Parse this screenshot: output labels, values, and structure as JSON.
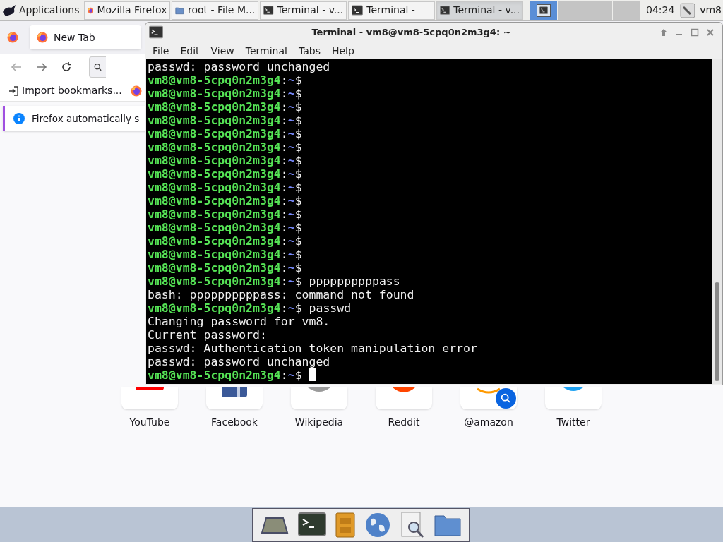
{
  "taskbar": {
    "apps_menu": "Applications",
    "tasks": [
      {
        "kind": "firefox",
        "label": "Mozilla Firefox",
        "selected": false
      },
      {
        "kind": "folder",
        "label": "root - File M...",
        "selected": false
      },
      {
        "kind": "terminal",
        "label": "Terminal - v...",
        "selected": false
      },
      {
        "kind": "terminal",
        "label": "Terminal - ",
        "selected": false
      },
      {
        "kind": "terminal",
        "label": "Terminal - v...",
        "selected": true
      }
    ],
    "workspaces": [
      {
        "selected": true
      },
      {
        "selected": false
      },
      {
        "selected": false
      },
      {
        "selected": false
      }
    ],
    "clock": "04:24",
    "user": "vm8"
  },
  "firefox": {
    "tab": "New Tab",
    "bookmark": "Import bookmarks...",
    "notification": "Firefox automatically s",
    "top_sites": [
      {
        "kind": "youtube",
        "label": "YouTube"
      },
      {
        "kind": "facebook",
        "label": "Facebook"
      },
      {
        "kind": "wikipedia",
        "label": "Wikipedia"
      },
      {
        "kind": "reddit",
        "label": "Reddit"
      },
      {
        "kind": "amazon",
        "label": "@amazon",
        "search_badge": true
      },
      {
        "kind": "twitter",
        "label": "Twitter"
      }
    ]
  },
  "terminal": {
    "title": "Terminal - vm8@vm8-5cpq0n2m3g4: ~",
    "menu": [
      "File",
      "Edit",
      "View",
      "Terminal",
      "Tabs",
      "Help"
    ],
    "lines": [
      {
        "kind": "output",
        "text": "passwd: password unchanged"
      },
      {
        "kind": "prompt",
        "user": "vm8@vm8-5cpq0n2m3g4",
        "sep": ":",
        "path": "~",
        "symbol": "$"
      },
      {
        "kind": "prompt",
        "user": "vm8@vm8-5cpq0n2m3g4",
        "sep": ":",
        "path": "~",
        "symbol": "$"
      },
      {
        "kind": "prompt",
        "user": "vm8@vm8-5cpq0n2m3g4",
        "sep": ":",
        "path": "~",
        "symbol": "$"
      },
      {
        "kind": "prompt",
        "user": "vm8@vm8-5cpq0n2m3g4",
        "sep": ":",
        "path": "~",
        "symbol": "$"
      },
      {
        "kind": "prompt",
        "user": "vm8@vm8-5cpq0n2m3g4",
        "sep": ":",
        "path": "~",
        "symbol": "$"
      },
      {
        "kind": "prompt",
        "user": "vm8@vm8-5cpq0n2m3g4",
        "sep": ":",
        "path": "~",
        "symbol": "$"
      },
      {
        "kind": "prompt",
        "user": "vm8@vm8-5cpq0n2m3g4",
        "sep": ":",
        "path": "~",
        "symbol": "$"
      },
      {
        "kind": "prompt",
        "user": "vm8@vm8-5cpq0n2m3g4",
        "sep": ":",
        "path": "~",
        "symbol": "$"
      },
      {
        "kind": "prompt",
        "user": "vm8@vm8-5cpq0n2m3g4",
        "sep": ":",
        "path": "~",
        "symbol": "$"
      },
      {
        "kind": "prompt",
        "user": "vm8@vm8-5cpq0n2m3g4",
        "sep": ":",
        "path": "~",
        "symbol": "$"
      },
      {
        "kind": "prompt",
        "user": "vm8@vm8-5cpq0n2m3g4",
        "sep": ":",
        "path": "~",
        "symbol": "$"
      },
      {
        "kind": "prompt",
        "user": "vm8@vm8-5cpq0n2m3g4",
        "sep": ":",
        "path": "~",
        "symbol": "$"
      },
      {
        "kind": "prompt",
        "user": "vm8@vm8-5cpq0n2m3g4",
        "sep": ":",
        "path": "~",
        "symbol": "$"
      },
      {
        "kind": "prompt",
        "user": "vm8@vm8-5cpq0n2m3g4",
        "sep": ":",
        "path": "~",
        "symbol": "$"
      },
      {
        "kind": "prompt",
        "user": "vm8@vm8-5cpq0n2m3g4",
        "sep": ":",
        "path": "~",
        "symbol": "$"
      },
      {
        "kind": "prompt",
        "user": "vm8@vm8-5cpq0n2m3g4",
        "sep": ":",
        "path": "~",
        "symbol": "$",
        "command": "ppppppppppass"
      },
      {
        "kind": "output",
        "text": "bash: ppppppppppass: command not found"
      },
      {
        "kind": "prompt",
        "user": "vm8@vm8-5cpq0n2m3g4",
        "sep": ":",
        "path": "~",
        "symbol": "$",
        "command": "passwd"
      },
      {
        "kind": "output",
        "text": "Changing password for vm8."
      },
      {
        "kind": "output",
        "text": "Current password:"
      },
      {
        "kind": "output",
        "text": "passwd: Authentication token manipulation error"
      },
      {
        "kind": "output",
        "text": "passwd: password unchanged"
      },
      {
        "kind": "prompt",
        "user": "vm8@vm8-5cpq0n2m3g4",
        "sep": ":",
        "path": "~",
        "symbol": "$",
        "cursor": true
      }
    ]
  },
  "dock": [
    {
      "kind": "desktop"
    },
    {
      "kind": "terminal"
    },
    {
      "kind": "cabinet"
    },
    {
      "kind": "globe"
    },
    {
      "kind": "search-doc"
    },
    {
      "kind": "folder"
    }
  ]
}
